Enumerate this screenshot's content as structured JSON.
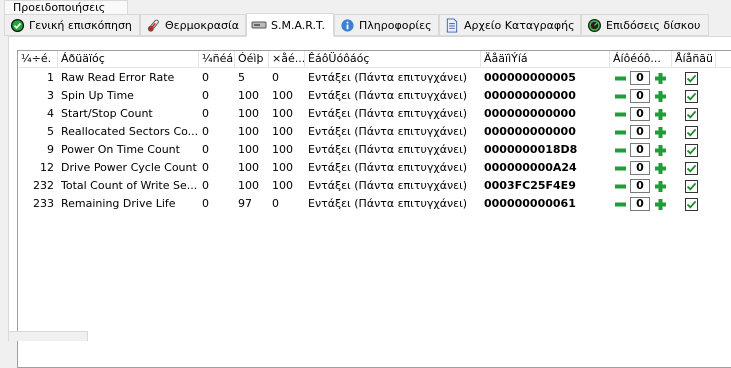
{
  "top_tab": {
    "label": "Προειδοποιήσεις"
  },
  "tabs": [
    {
      "label": "Γενική επισκόπηση",
      "icon": "green-check-circle-icon"
    },
    {
      "label": "Θερμοκρασία",
      "icon": "thermometer-icon"
    },
    {
      "label": "S.M.A.R.T.",
      "icon": "smart-drive-icon"
    },
    {
      "label": "Πληροφορίες",
      "icon": "info-icon"
    },
    {
      "label": "Αρχείο Καταγραφής",
      "icon": "log-file-icon"
    },
    {
      "label": "Επιδόσεις δίσκου",
      "icon": "gauge-icon"
    }
  ],
  "active_tab": "S.M.A.R.T.",
  "columns": {
    "id": "¼÷é.",
    "attribute": "Áðüäïóç",
    "value": "¼ñéá",
    "worst": "Óéìþ",
    "threshold": "×åé...",
    "status": "ÊáôÜóôáóç",
    "raw": "ÄåäïìÝíá",
    "offset": "Áíôéóô...",
    "enabled": "Åíåñãü"
  },
  "rows": [
    {
      "id": "1",
      "attribute": "Raw Read Error Rate",
      "value": "0",
      "worst": "5",
      "threshold": "0",
      "status": "Εντάξει (Πάντα επιτυγχάνει)",
      "raw": "000000000005",
      "offset": "0",
      "enabled": true
    },
    {
      "id": "3",
      "attribute": "Spin Up Time",
      "value": "0",
      "worst": "100",
      "threshold": "100",
      "status": "Εντάξει (Πάντα επιτυγχάνει)",
      "raw": "000000000000",
      "offset": "0",
      "enabled": true
    },
    {
      "id": "4",
      "attribute": "Start/Stop Count",
      "value": "0",
      "worst": "100",
      "threshold": "100",
      "status": "Εντάξει (Πάντα επιτυγχάνει)",
      "raw": "000000000000",
      "offset": "0",
      "enabled": true
    },
    {
      "id": "5",
      "attribute": "Reallocated Sectors Co...",
      "value": "0",
      "worst": "100",
      "threshold": "100",
      "status": "Εντάξει (Πάντα επιτυγχάνει)",
      "raw": "000000000000",
      "offset": "0",
      "enabled": true
    },
    {
      "id": "9",
      "attribute": "Power On Time Count",
      "value": "0",
      "worst": "100",
      "threshold": "100",
      "status": "Εντάξει (Πάντα επιτυγχάνει)",
      "raw": "0000000018D8",
      "offset": "0",
      "enabled": true
    },
    {
      "id": "12",
      "attribute": "Drive Power Cycle Count",
      "value": "0",
      "worst": "100",
      "threshold": "100",
      "status": "Εντάξει (Πάντα επιτυγχάνει)",
      "raw": "000000000A24",
      "offset": "0",
      "enabled": true
    },
    {
      "id": "232",
      "attribute": "Total Count of Write Se...",
      "value": "0",
      "worst": "100",
      "threshold": "100",
      "status": "Εντάξει (Πάντα επιτυγχάνει)",
      "raw": "0003FC25F4E9",
      "offset": "0",
      "enabled": true
    },
    {
      "id": "233",
      "attribute": "Remaining Drive Life",
      "value": "0",
      "worst": "97",
      "threshold": "0",
      "status": "Εντάξει (Πάντα επιτυγχάνει)",
      "raw": "000000000061",
      "offset": "0",
      "enabled": true
    }
  ],
  "colors": {
    "accent_green": "#16a34a",
    "stepper_green": "#1f9d3a"
  }
}
